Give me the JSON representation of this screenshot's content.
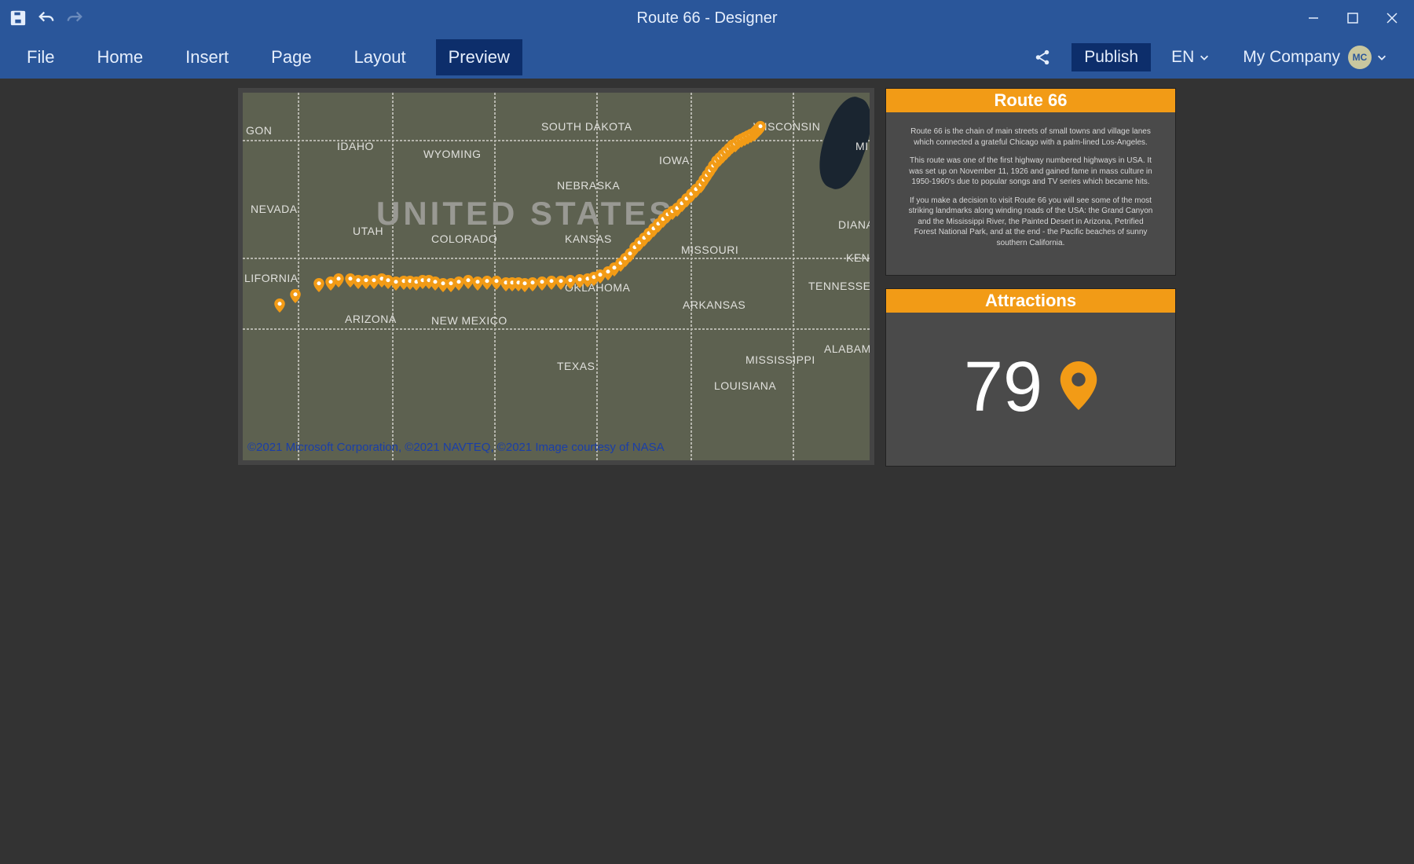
{
  "titlebar": {
    "title": "Route 66 - Designer"
  },
  "menu": {
    "tabs": [
      "File",
      "Home",
      "Insert",
      "Page",
      "Layout",
      "Preview"
    ],
    "active": "Preview",
    "share_label": "share",
    "publish": "Publish",
    "lang": "EN",
    "company_label": "My  Company",
    "avatar": "MC"
  },
  "map": {
    "big_label": "UNITED STATES",
    "credit": "©2021 Microsoft Corporation, ©2021 NAVTEQ, ©2021 Image courtesy of NASA",
    "states": {
      "oregon": "GON",
      "idaho": "IDAHO",
      "wyoming": "WYOMING",
      "southdakota": "SOUTH DAKOTA",
      "wisconsin": "WISCONSIN",
      "mi": "MI",
      "iowa": "IOWA",
      "nebraska": "NEBRASKA",
      "nevada": "NEVADA",
      "utah": "UTAH",
      "colorado": "COLORADO",
      "kansas": "KANSAS",
      "missouri": "MISSOURI",
      "diana": "DIANA",
      "kentucky": "KENTUCKY",
      "california": "LIFORNIA",
      "arizona": "ARIZONA",
      "newmexico": "NEW MEXICO",
      "oklahoma": "OKLAHOMA",
      "arkansas": "ARKANSAS",
      "tennessee": "TENNESSEE",
      "texas": "TEXAS",
      "mississippi": "MISSISSIPPI",
      "louisiana": "LOUISIANA",
      "alabama": "ALABAM"
    }
  },
  "panels": {
    "route66": {
      "title": "Route 66",
      "p1": "Route 66 is the chain of main streets of small towns and village lanes which connected a grateful Chicago with a palm-lined Los-Angeles.",
      "p2": "This route was one of the first highway numbered highways in USA. It was set up on November 11, 1926 and gained fame in mass culture in 1950-1960's due to popular songs and TV series which became hits.",
      "p3": "If you make a decision to visit Route 66 you will see some of the most striking landmarks along winding roads of the USA: the Grand Canyon and the Mississippi River, the Painted Desert in Arizona, Petrified Forest National Park, and at the end - the Pacific beaches of sunny southern California."
    },
    "attractions": {
      "title": "Attractions",
      "count": "79"
    }
  },
  "colors": {
    "brand": "#2a569a",
    "accent": "#f29b16"
  }
}
